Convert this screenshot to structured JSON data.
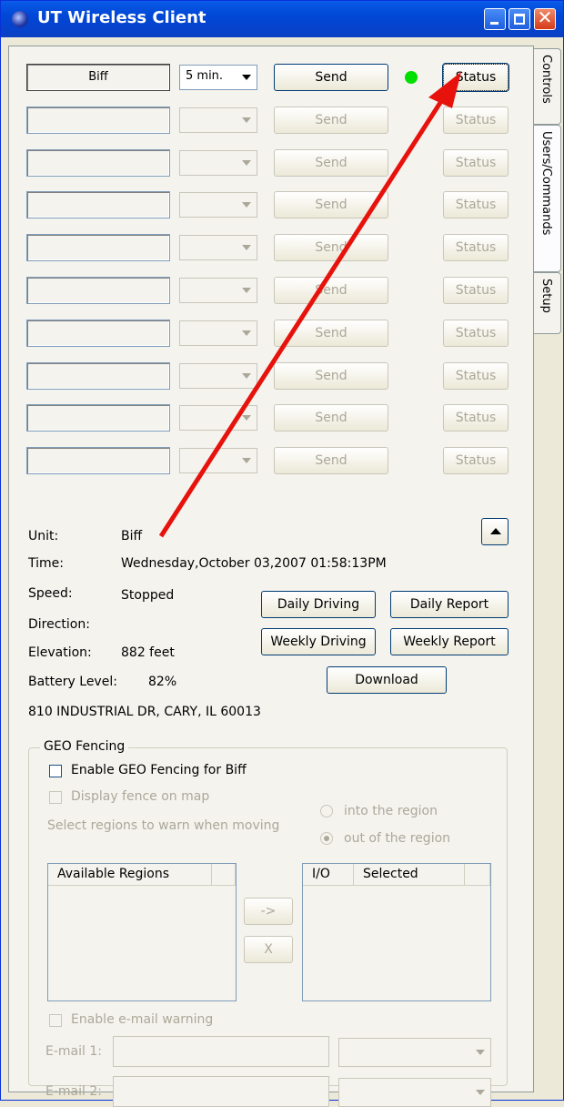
{
  "window": {
    "title": "UT Wireless Client"
  },
  "tabs": [
    "Controls",
    "Users/Commands",
    "Setup"
  ],
  "units": [
    {
      "name": "Biff",
      "interval": "5 min.",
      "send": "Send",
      "status": "Status",
      "active": true
    },
    {
      "name": "",
      "interval": "",
      "send": "Send",
      "status": "Status",
      "active": false
    },
    {
      "name": "",
      "interval": "",
      "send": "Send",
      "status": "Status",
      "active": false
    },
    {
      "name": "",
      "interval": "",
      "send": "Send",
      "status": "Status",
      "active": false
    },
    {
      "name": "",
      "interval": "",
      "send": "Send",
      "status": "Status",
      "active": false
    },
    {
      "name": "",
      "interval": "",
      "send": "Send",
      "status": "Status",
      "active": false
    },
    {
      "name": "",
      "interval": "",
      "send": "Send",
      "status": "Status",
      "active": false
    },
    {
      "name": "",
      "interval": "",
      "send": "Send",
      "status": "Status",
      "active": false
    },
    {
      "name": "",
      "interval": "",
      "send": "Send",
      "status": "Status",
      "active": false
    },
    {
      "name": "",
      "interval": "",
      "send": "Send",
      "status": "Status",
      "active": false
    }
  ],
  "info": {
    "unit_label": "Unit:",
    "unit_value": "Biff",
    "time_label": "Time:",
    "time_value": "Wednesday,October 03,2007 01:58:13PM",
    "speed_label": "Speed:",
    "speed_value": "Stopped",
    "direction_label": "Direction:",
    "elevation_label": "Elevation:",
    "elevation_value": "882 feet",
    "battery_label": "Battery Level:",
    "battery_value": "82%",
    "address": "810 INDUSTRIAL DR, CARY, IL 60013"
  },
  "reports": {
    "daily_driving": "Daily Driving",
    "daily_report": "Daily Report",
    "weekly_driving": "Weekly Driving",
    "weekly_report": "Weekly Report",
    "download": "Download"
  },
  "geo": {
    "title": "GEO Fencing",
    "enable": "Enable GEO Fencing for Biff",
    "display": "Display fence on map",
    "select_regions": "Select regions to warn when moving",
    "into": "into the region",
    "out_of": "out of the region",
    "available_header": "Available Regions",
    "io_header": "I/O",
    "selected_header": "Selected",
    "add_btn": "->",
    "remove_btn": "X",
    "email_warning": "Enable e-mail warning",
    "email1_label": "E-mail 1:",
    "email2_label": "E-mail 2:"
  },
  "colors": {
    "led": "#00e000",
    "annotation_arrow": "#e8120c",
    "titlebar": "#0047d6"
  }
}
